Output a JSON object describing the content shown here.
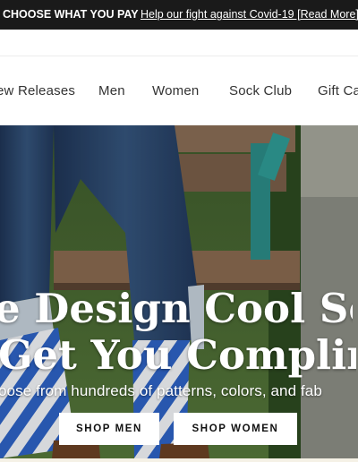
{
  "promo_bar": {
    "headline": "CHOOSE WHAT YOU PAY",
    "link": "Help our fight against Covid-19 [Read More]"
  },
  "nav": {
    "items": [
      "ew Releases",
      "Men",
      "Women",
      "Sock Club",
      "Gift Ca"
    ]
  },
  "hero": {
    "title_line1": "e Design Cool Soc",
    "title_line2": "Get You Complin",
    "subtitle": "oose from hundreds of patterns, colors, and fab",
    "buttons": {
      "men": "SHOP MEN",
      "women": "SHOP WOMEN"
    }
  },
  "colors": {
    "promo_bg": "#1a1a1a",
    "text_dark": "#333333",
    "button_bg": "#ffffff",
    "sock_blue": "#2e63c6"
  }
}
